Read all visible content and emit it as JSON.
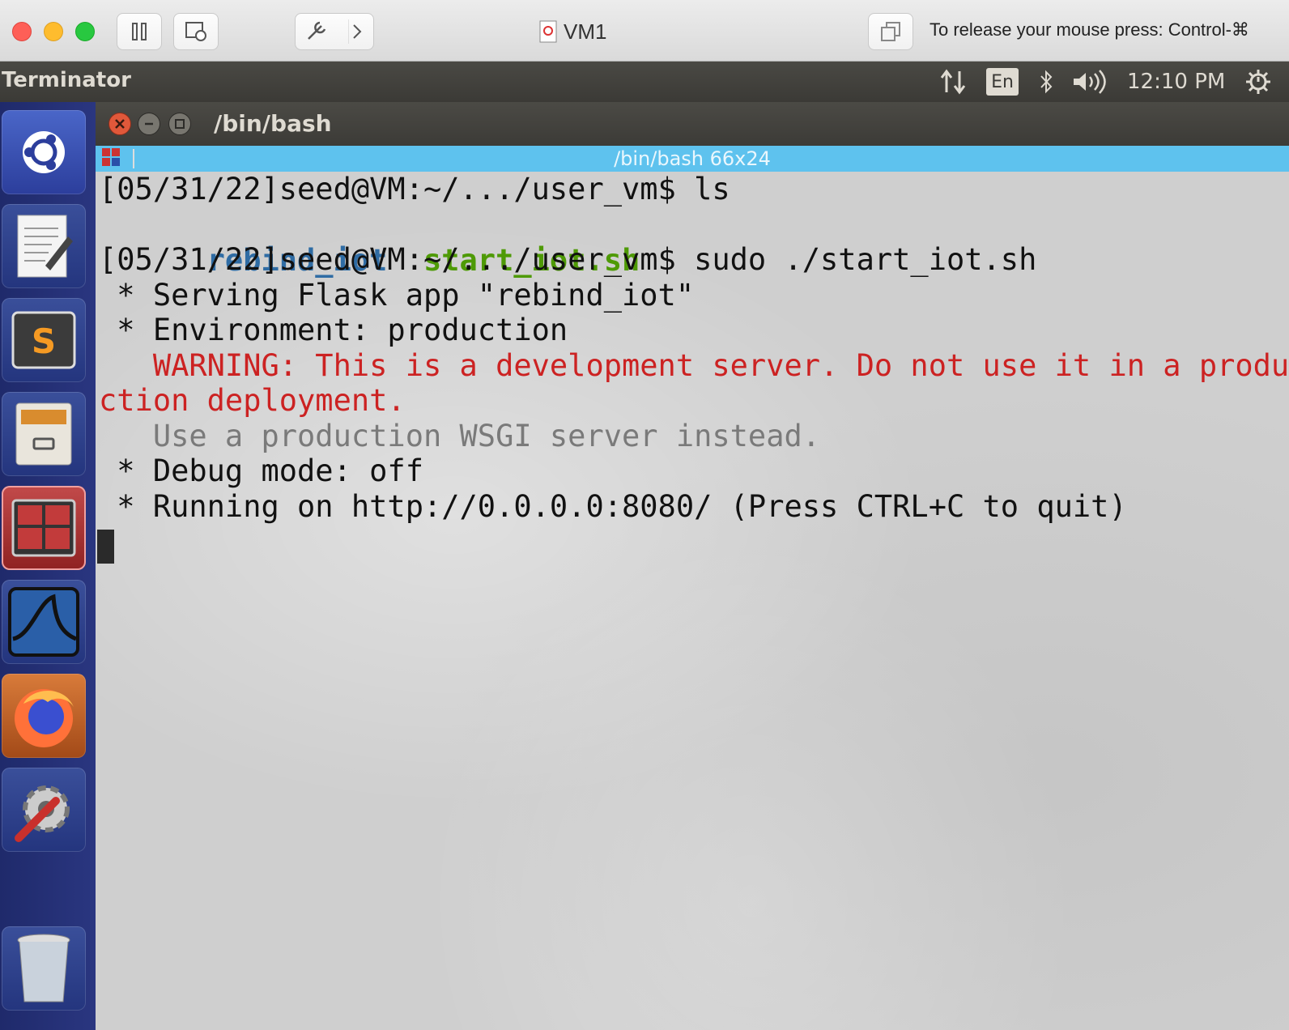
{
  "host": {
    "vm_title": "VM1",
    "release_hint": "To release your mouse press: Control-⌘"
  },
  "panel": {
    "app_name": "Terminator",
    "lang": "En",
    "clock": "12:10 PM"
  },
  "launcher": {
    "items": [
      "ubuntu-dash",
      "text-editor",
      "sublime-text",
      "file-manager",
      "terminator",
      "wireshark",
      "firefox",
      "system-settings",
      "trash"
    ]
  },
  "terminal": {
    "window_title": "/bin/bash",
    "header_title": "/bin/bash 66x24",
    "lines": {
      "l1": "[05/31/22]seed@VM:~/.../user_vm$ ls",
      "l2a": "rebind_iot",
      "l2b": "start_iot.sh",
      "l3": "[05/31/22]seed@VM:~/.../user_vm$ sudo ./start_iot.sh",
      "l4": " * Serving Flask app \"rebind_iot\"",
      "l5": " * Environment: production",
      "l6": "   WARNING: This is a development server. Do not use it in a produ",
      "l7": "ction deployment.",
      "l8": "   Use a production WSGI server instead.",
      "l9": " * Debug mode: off",
      "l10": " * Running on http://0.0.0.0:8080/ (Press CTRL+C to quit)"
    }
  },
  "colors": {
    "header_accent": "#5ec2ee",
    "warning": "#cc2222",
    "dir": "#2f6ca4",
    "exec": "#4e9a06"
  }
}
